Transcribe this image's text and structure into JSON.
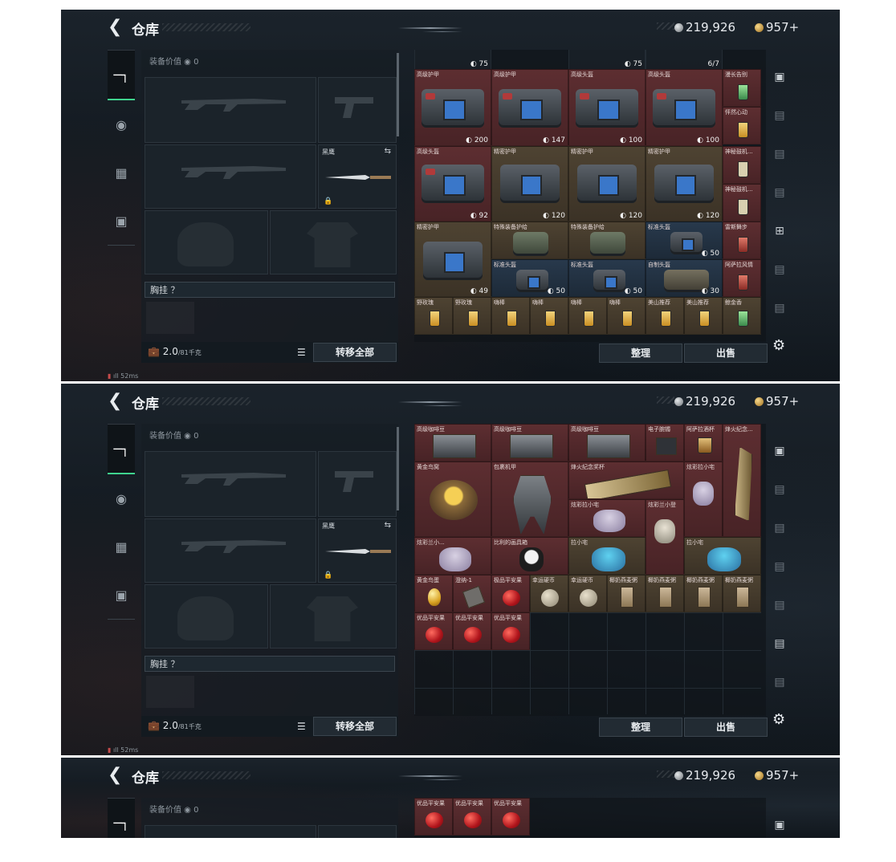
{
  "header": {
    "title": "仓库",
    "silver": "219,926",
    "gold": "957+"
  },
  "equipment": {
    "value_label": "装备价值",
    "value": "0",
    "knife_label": "黑鹰",
    "rig_label": "胸挂 ？",
    "weight_value": "2.0",
    "weight_unit": "/81千克",
    "transfer_all": "转移全部"
  },
  "actions": {
    "sort": "整理",
    "sell": "出售"
  },
  "status": {
    "signal": "52ms"
  },
  "panel1": {
    "top_row": [
      {
        "count": "75"
      },
      {
        "count": "75"
      },
      {
        "count": "6/7"
      }
    ],
    "rows": [
      [
        {
          "name": "高级护甲",
          "value": "200",
          "color": "r"
        },
        {
          "name": "高级护甲",
          "value": "147",
          "color": "r"
        },
        {
          "name": "高级头盔",
          "value": "100",
          "color": "r"
        },
        {
          "name": "高级头盔",
          "value": "100",
          "color": "r"
        }
      ],
      [
        {
          "name": "高级头盔",
          "value": "92",
          "color": "r"
        },
        {
          "name": "精密护甲",
          "value": "120",
          "color": "o"
        },
        {
          "name": "精密护甲",
          "value": "120",
          "color": "o"
        },
        {
          "name": "精密护甲",
          "value": "120",
          "color": "o"
        }
      ],
      [
        {
          "name": "精密护甲",
          "value": "49",
          "color": "o"
        },
        {
          "name": "特殊装备护给",
          "value": "",
          "color": "o"
        },
        {
          "name": "特殊装备护给",
          "value": "",
          "color": "o"
        },
        {
          "name": "标准头盔",
          "value": "50",
          "color": "b"
        },
        {
          "name": "标准头盔",
          "value": "50",
          "color": "b"
        },
        {
          "name": "标准头盔",
          "value": "50",
          "color": "b"
        },
        {
          "name": "自制头盔",
          "value": "30",
          "color": "b"
        }
      ],
      [
        {
          "name": "野玫瑰"
        },
        {
          "name": "野玫瑰"
        },
        {
          "name": "嗨棒"
        },
        {
          "name": "嗨棒"
        },
        {
          "name": "嗨棒"
        },
        {
          "name": "嗨棒"
        },
        {
          "name": "美山推荐"
        },
        {
          "name": "美山推荐"
        },
        {
          "name": "鲸金香"
        }
      ]
    ],
    "right_col": [
      "漫长告别",
      "怦然心动",
      "神秘鼓机...",
      "神秘鼓机...",
      "雷斯舞步",
      "阿萨拉风情"
    ]
  },
  "panel2": {
    "row1": [
      "高级咖啡豆",
      "高级咖啡豆",
      "高级咖啡豆",
      "电子腕镯",
      "阿萨拉酒杯",
      "烽火纪念..."
    ],
    "row2": [
      "黄金鸟窝",
      "包裹机甲",
      "烽火纪念奖杯",
      "炫彩拉小宅",
      "炫彩拉小宅",
      "炫彩兰小登"
    ],
    "row3": [
      "炫彩兰小...",
      "比利的画具箱",
      "拉小宅",
      "拉小宅"
    ],
    "row4": [
      "黄金鸟蛋",
      "澄纳-1",
      "极品平安果",
      "幸运硬币",
      "幸运硬币",
      "椰奶燕麦粥",
      "椰奶燕麦粥",
      "椰奶燕麦粥",
      "椰奶燕麦粥"
    ],
    "row5": [
      "优品平安果",
      "优品平安果",
      "优品平安果"
    ]
  }
}
